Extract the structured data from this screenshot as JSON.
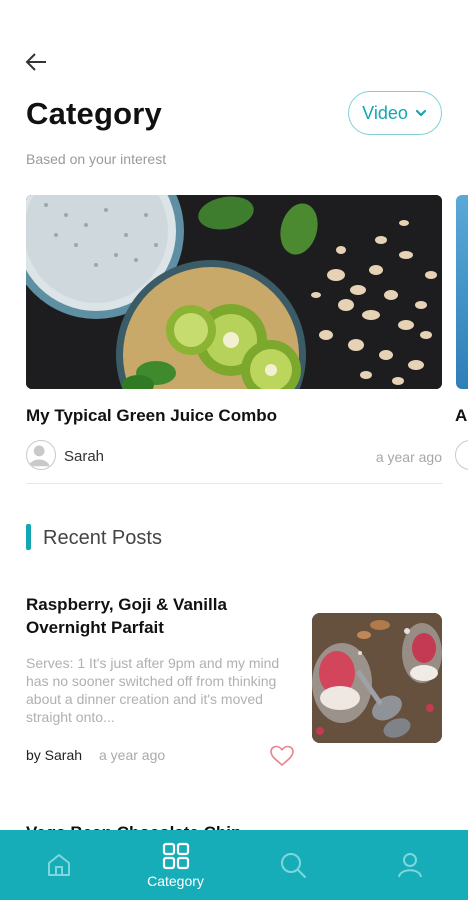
{
  "header": {
    "title": "Category",
    "subtitle": "Based on your interest",
    "filter": {
      "selected": "Video"
    }
  },
  "featured": {
    "title": "My Typical Green Juice Combo",
    "author": "Sarah",
    "time": "a year ago",
    "next_title_peek": "A"
  },
  "recent": {
    "section_title": "Recent Posts",
    "posts": [
      {
        "title": "Raspberry, Goji & Vanilla Overnight Parfait",
        "excerpt": "Serves: 1 It's just after 9pm and my mind has no sooner switched off from thinking about a dinner creation and it's moved straight onto...",
        "by": "by Sarah",
        "time": "a year ago"
      }
    ],
    "next_post_peek": "Vega Bean Chocolate Chip..."
  },
  "bottom_nav": {
    "items": [
      {
        "icon": "home-icon",
        "label": ""
      },
      {
        "icon": "grid-icon",
        "label": "Category",
        "active": true
      },
      {
        "icon": "search-icon",
        "label": ""
      },
      {
        "icon": "profile-icon",
        "label": ""
      }
    ]
  },
  "colors": {
    "accent": "#13a6b3",
    "nav_bg": "#16adb9",
    "heart": "#e7848f"
  }
}
